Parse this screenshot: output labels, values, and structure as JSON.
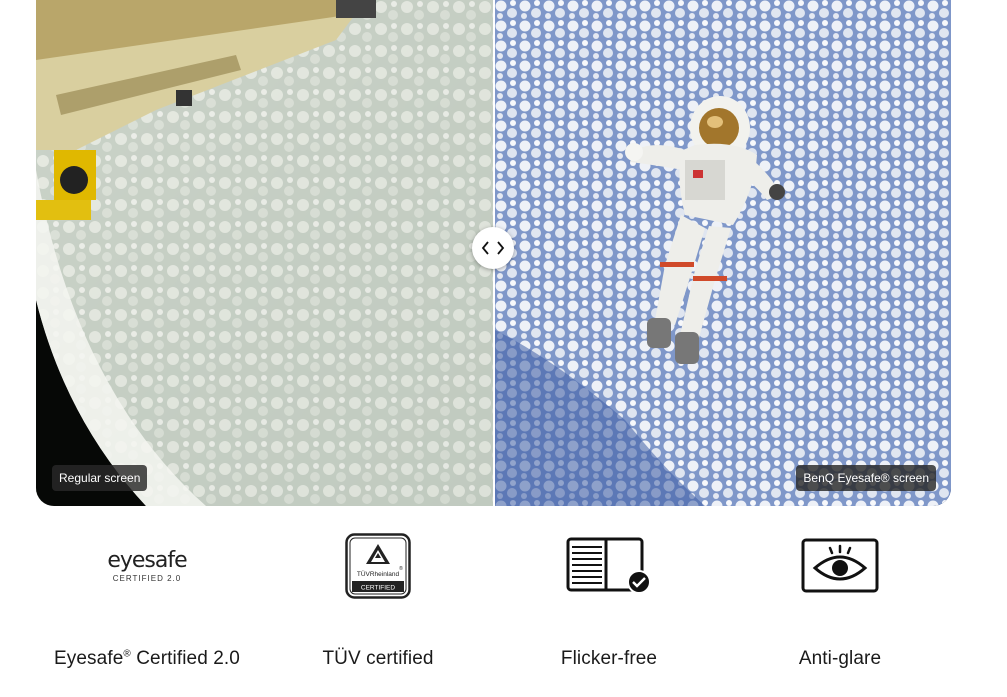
{
  "comparison": {
    "left_label": "Regular screen",
    "right_label": "BenQ Eyesafe® screen",
    "handle_icon": "chevron-left-right-icon"
  },
  "features": [
    {
      "title": "Eyesafe",
      "title_sup": "®",
      "title_rest": " Certified 2.0",
      "icon": "eyesafe-logo",
      "logo_main": "eyesafe",
      "logo_sub": "CERTIFIED 2.0"
    },
    {
      "title": "TÜV certified",
      "icon": "tuv-rheinland-logo",
      "logo_brand": "TÜVRheinland",
      "logo_mark": "®",
      "logo_sub": "CERTIFIED"
    },
    {
      "title": "Flicker-free",
      "icon": "flicker-free-icon"
    },
    {
      "title": "Anti-glare",
      "icon": "eye-icon"
    }
  ]
}
